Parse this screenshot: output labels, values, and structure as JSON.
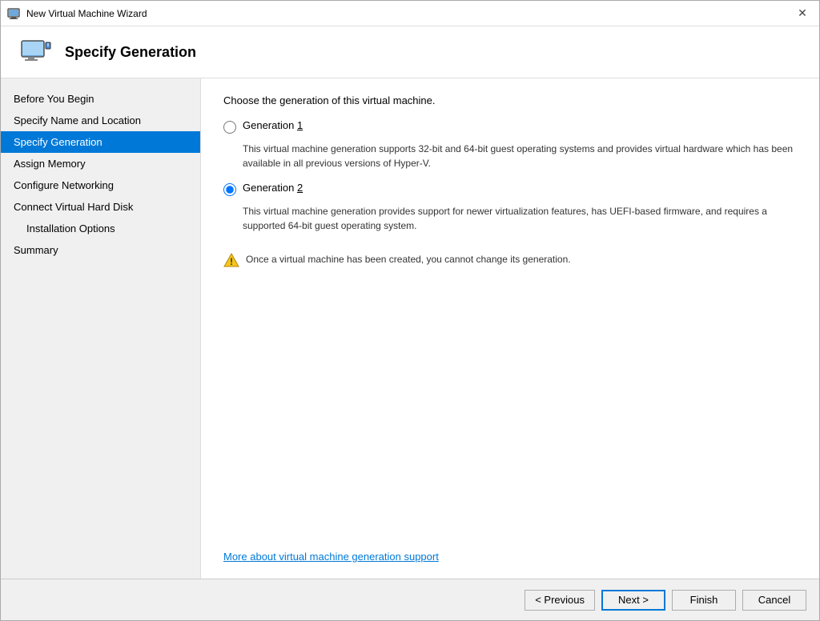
{
  "window": {
    "title": "New Virtual Machine Wizard",
    "close_label": "✕"
  },
  "header": {
    "title": "Specify Generation"
  },
  "sidebar": {
    "items": [
      {
        "id": "before-you-begin",
        "label": "Before You Begin",
        "active": false,
        "indented": false
      },
      {
        "id": "specify-name",
        "label": "Specify Name and Location",
        "active": false,
        "indented": false
      },
      {
        "id": "specify-generation",
        "label": "Specify Generation",
        "active": true,
        "indented": false
      },
      {
        "id": "assign-memory",
        "label": "Assign Memory",
        "active": false,
        "indented": false
      },
      {
        "id": "configure-networking",
        "label": "Configure Networking",
        "active": false,
        "indented": false
      },
      {
        "id": "connect-vhd",
        "label": "Connect Virtual Hard Disk",
        "active": false,
        "indented": false
      },
      {
        "id": "installation-options",
        "label": "Installation Options",
        "active": false,
        "indented": true
      },
      {
        "id": "summary",
        "label": "Summary",
        "active": false,
        "indented": false
      }
    ]
  },
  "main": {
    "description": "Choose the generation of this virtual machine.",
    "generation1": {
      "label_prefix": "Generation ",
      "label_number": "1",
      "desc": "This virtual machine generation supports 32-bit and 64-bit guest operating systems and provides virtual hardware which has been available in all previous versions of Hyper-V."
    },
    "generation2": {
      "label_prefix": "Generation ",
      "label_number": "2",
      "desc": "This virtual machine generation provides support for newer virtualization features, has UEFI-based firmware, and requires a supported 64-bit guest operating system."
    },
    "warning": "Once a virtual machine has been created, you cannot change its generation.",
    "help_link": "More about virtual machine generation support"
  },
  "footer": {
    "previous_label": "< Previous",
    "next_label": "Next >",
    "finish_label": "Finish",
    "cancel_label": "Cancel"
  }
}
